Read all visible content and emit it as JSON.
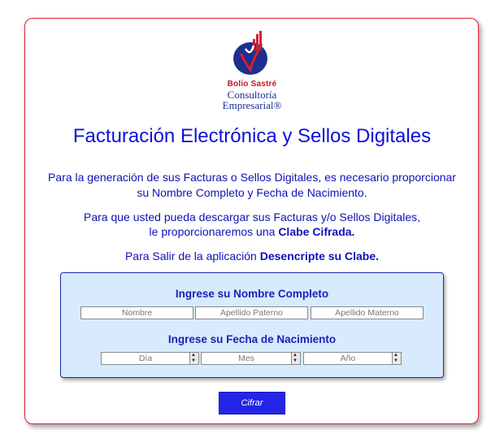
{
  "brand": {
    "line1": "Bolio Sastré",
    "line2": "Consultoría",
    "line3": "Empresarial®"
  },
  "title": "Facturación Electrónica y Sellos Digitales",
  "intro": {
    "line1": "Para la generación de sus Facturas o Sellos Digitales, es necesario proporcionar",
    "line2": "su Nombre Completo y Fecha de Nacimiento."
  },
  "download": {
    "line1": "Para que usted pueda descargar sus Facturas y/o Sellos Digitales,",
    "line2_prefix": "le proporcionaremos una ",
    "line2_bold": "Clabe Cifrada."
  },
  "exit": {
    "prefix": "Para Salir de la aplicación ",
    "bold": "Desencripte su Clabe."
  },
  "form": {
    "name_heading": "Ingrese su Nombre Completo",
    "nombre_placeholder": "Nombre",
    "paterno_placeholder": "Apellido Paterno",
    "materno_placeholder": "Apellido Materno",
    "birth_heading": "Ingrese su Fecha de Nacimiento",
    "dia_placeholder": "Día",
    "mes_placeholder": "Mes",
    "anio_placeholder": "Año",
    "submit_label": "Cifrar"
  },
  "colors": {
    "accent_blue": "#1010d8",
    "brand_red": "#c0182a",
    "panel_bg": "#d7ebfd"
  }
}
